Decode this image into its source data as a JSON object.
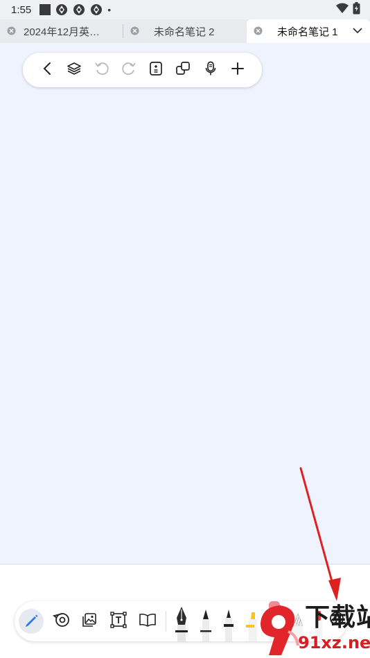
{
  "status_bar": {
    "time": "1:55",
    "dot": "•"
  },
  "tabs": [
    {
      "label": "2024年12月英…"
    },
    {
      "label": "未命名笔记 2"
    },
    {
      "label": "未命名笔记 1",
      "active": true
    }
  ],
  "top_toolbar": {
    "icons": [
      "back-icon",
      "layers-icon",
      "undo-icon",
      "redo-icon",
      "page-settings-icon",
      "copy-icon",
      "microphone-icon",
      "add-icon"
    ]
  },
  "bottom_toolbar": {
    "tools": [
      "pen-tool-icon",
      "tape-icon",
      "image-icon",
      "text-box-icon",
      "book-icon"
    ],
    "pens": [
      "fountain-pen",
      "ballpoint-pen",
      "fineliner-pen",
      "highlighter-yellow",
      "marker-pink",
      "pencil",
      "brush-red"
    ],
    "extra": "add-pen-icon"
  },
  "colors": {
    "canvas": "#eff3fe",
    "accent": "#2b7de9",
    "arrow": "#e02020",
    "watermark_red": "#d81d24"
  },
  "watermark": {
    "text": "下载站",
    "domain": "91xz.net"
  }
}
